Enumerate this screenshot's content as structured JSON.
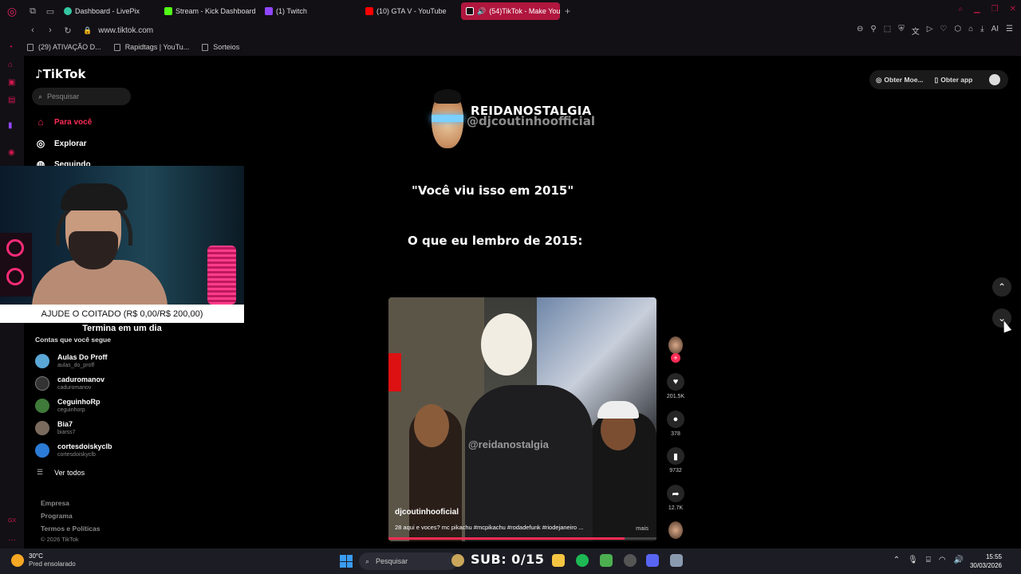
{
  "browser": {
    "tabs": [
      {
        "label": "Dashboard - LivePix",
        "color": "#34c6a1"
      },
      {
        "label": "Stream - Kick Dashboard",
        "color": "#53fc18"
      },
      {
        "label": "(1) Twitch",
        "color": "#9146ff"
      },
      {
        "label": "(10) GTA V - YouTube",
        "color": "#ff0000"
      },
      {
        "label": "(54)TikTok - Make You",
        "color": "#ffffff"
      }
    ],
    "url": "www.tiktok.com",
    "bookmarks": [
      "(29) ATIVAÇÃO D...",
      "Rapidtags | YouTu...",
      "Sorteios"
    ],
    "ai_label": "AI"
  },
  "tiktok": {
    "logo": "TikTok",
    "search_placeholder": "Pesquisar",
    "nav": {
      "for_you": "Para você",
      "explore": "Explorar",
      "following": "Seguindo"
    },
    "following_header": "Contas que você segue",
    "accounts": [
      {
        "name": "Aulas Do Proff",
        "handle": "aulas_do_proff",
        "color": "#5aa7d6"
      },
      {
        "name": "caduromanov",
        "handle": "caduromanov",
        "color": "#333333"
      },
      {
        "name": "CeguinhoRp",
        "handle": "ceguinhorp",
        "color": "#3f7a3a"
      },
      {
        "name": "Bia7",
        "handle": "biarss7",
        "color": "#7a6a5e"
      },
      {
        "name": "cortesdoiskyclb",
        "handle": "cortesdoiskyclb",
        "color": "#2c7bd6"
      }
    ],
    "see_all": "Ver todos",
    "footer": [
      "Empresa",
      "Programa",
      "Termos e Políticas"
    ],
    "copyright": "© 2026 TikTok",
    "top_buttons": {
      "coins": "Obter Moe...",
      "app": "Obter app"
    }
  },
  "overlay": {
    "donation": "AJUDE O COITADO (R$ 0,00/R$ 200,00)",
    "donation_sub": "Termina em um dia",
    "sub_counter": "SUB: 0/15"
  },
  "post": {
    "title": "REIDANOSTALGIA",
    "handle_overlay": "@djcoutinhoofficial",
    "caption_line1": "\"Você viu isso em 2015\"",
    "caption_line2": "O que eu lembro de 2015:",
    "watermark": "@reidanostalgia",
    "author": "djcoutinhooficial",
    "description": "28 aqui e voces? mc pikachu #mcpikachu #rodadefunk #riodejaneiro ...",
    "more": "mais",
    "progress": 0.88,
    "likes": "201.5K",
    "comments": "378",
    "saves": "9732",
    "shares": "12.7K"
  },
  "taskbar": {
    "temp": "30°C",
    "weather": "Pred ensolarado",
    "search": "Pesquisar",
    "time": "15:55",
    "date": "30/03/2026"
  }
}
